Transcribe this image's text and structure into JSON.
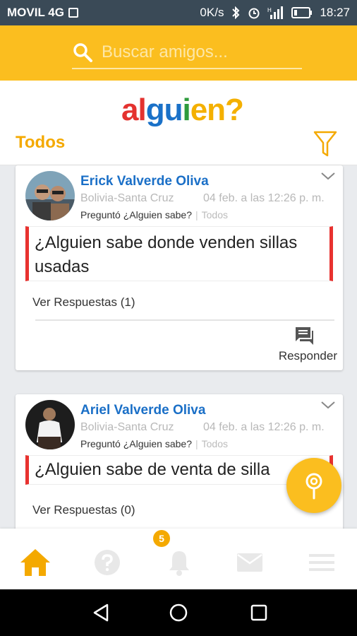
{
  "status": {
    "carrier": "MOVIL 4G",
    "speed": "0K/s",
    "time": "18:27"
  },
  "search": {
    "placeholder": "Buscar amigos..."
  },
  "brand": {
    "logo_parts": [
      "al",
      "gu",
      "i",
      "en?"
    ]
  },
  "filter": {
    "label": "Todos"
  },
  "posts": [
    {
      "author": "Erick Valverde Oliva",
      "location": "Bolivia-Santa Cruz",
      "date": "04 feb. a las 12:26 p. m.",
      "action": "Preguntó ¿Alguien sabe?",
      "category": "Todos",
      "question": "¿Alguien sabe donde venden sillas usadas",
      "answers_link": "Ver Respuestas (1)",
      "reply_label": "Responder"
    },
    {
      "author": "Ariel Valverde Oliva",
      "location": "Bolivia-Santa Cruz",
      "date": "04 feb. a las 12:26 p. m.",
      "action": "Preguntó ¿Alguien sabe?",
      "category": "Todos",
      "question": "¿Alguien sabe de venta de silla",
      "answers_link": "Ver Respuestas (0)"
    }
  ],
  "nav": {
    "notifications_count": "5",
    "items": [
      "home-icon",
      "help-icon",
      "bell-icon",
      "mail-icon",
      "menu-icon"
    ]
  },
  "colors": {
    "accent": "#fbbe1f",
    "accent_text": "#f4a900",
    "author": "#1a6fc7",
    "question_border": "#e8322f",
    "statusbar": "#3a4a57"
  }
}
